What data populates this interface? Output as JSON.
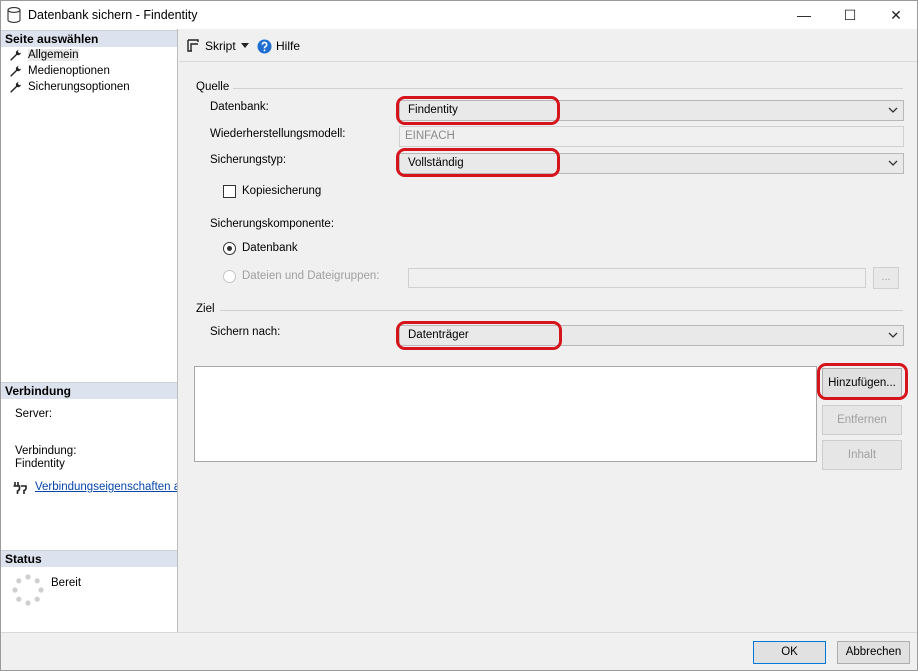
{
  "window": {
    "title": "Datenbank sichern - Findentity",
    "minimize_glyph": "—",
    "maximize_glyph": "☐",
    "close_glyph": "✕"
  },
  "left_panel": {
    "select_page_header": "Seite auswählen",
    "pages": [
      {
        "label": "Allgemein",
        "icon": "wrench-icon",
        "selected": true
      },
      {
        "label": "Medienoptionen",
        "icon": "wrench-icon",
        "selected": false
      },
      {
        "label": "Sicherungsoptionen",
        "icon": "wrench-icon",
        "selected": false
      }
    ],
    "connection_header": "Verbindung",
    "server_label": "Server:",
    "connection_label": "Verbindung:",
    "connection_value": "Findentity",
    "connection_properties_link": "Verbindungseigenschaften anzeigen",
    "status_header": "Status",
    "status_text": "Bereit"
  },
  "toolbar": {
    "script_label": "Skript",
    "help_label": "Hilfe"
  },
  "source": {
    "group_label": "Quelle",
    "database_label": "Datenbank:",
    "database_value": "Findentity",
    "recovery_model_label": "Wiederherstellungsmodell:",
    "recovery_model_value": "EINFACH",
    "backup_type_label": "Sicherungstyp:",
    "backup_type_value": "Vollständig",
    "copy_only_label": "Kopiesicherung",
    "copy_only_checked": false,
    "component_label": "Sicherungskomponente:",
    "component_database_label": "Datenbank",
    "component_files_label": "Dateien und Dateigruppen:",
    "files_button_label": "..."
  },
  "destination": {
    "group_label": "Ziel",
    "backup_to_label": "Sichern nach:",
    "backup_to_value": "Datenträger",
    "add_button": "Hinzufügen...",
    "remove_button": "Entfernen",
    "contents_button": "Inhalt"
  },
  "footer": {
    "ok_button": "OK",
    "cancel_button": "Abbrechen"
  },
  "colors": {
    "highlight_annotation": "#d5141c",
    "link": "#0645ad",
    "section_header_bg": "#dde3ee"
  }
}
